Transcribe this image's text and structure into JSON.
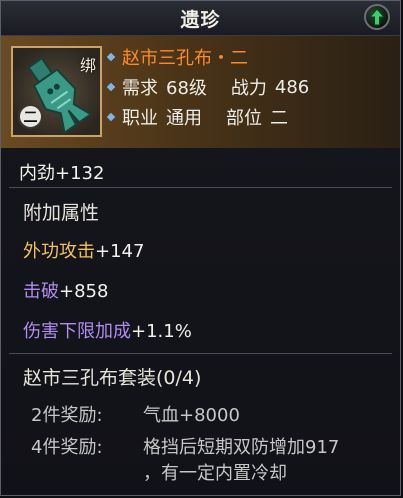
{
  "window": {
    "title": "遗珍"
  },
  "item": {
    "bind_tag": "绑",
    "grade_badge": "二",
    "name": "赵市三孔布・二",
    "require_label": "需求",
    "level": "68级",
    "power_label": "战力",
    "power": "486",
    "class_label": "职业",
    "class_value": "通用",
    "slot_label": "部位",
    "slot_value": "二"
  },
  "base_stat": {
    "name": "内劲",
    "value": "+132"
  },
  "extra": {
    "heading": "附加属性",
    "attrs": [
      {
        "name": "外功攻击",
        "value": "+147",
        "color": "#f0c35a"
      },
      {
        "name": "击破",
        "value": "+858",
        "color": "#b08cf0"
      },
      {
        "name": "伤害下限加成",
        "value": "+1.1%",
        "color": "#b08cf0"
      }
    ]
  },
  "set": {
    "title": "赵市三孔布套装(0/4)",
    "bonuses": [
      {
        "label": "2件奖励:",
        "text": "气血+8000"
      },
      {
        "label": "4件奖励:",
        "text": "格挡后短期双防增加917",
        "text2": "，有一定内置冷却"
      }
    ]
  },
  "colors": {
    "name": "#ff8a2a",
    "gold": "#f0c35a",
    "purple": "#b08cf0",
    "accent_green": "#3ad06a"
  },
  "icons": {
    "item": "bronze-coin-icon",
    "upgrade": "green-up-arrow-icon"
  }
}
